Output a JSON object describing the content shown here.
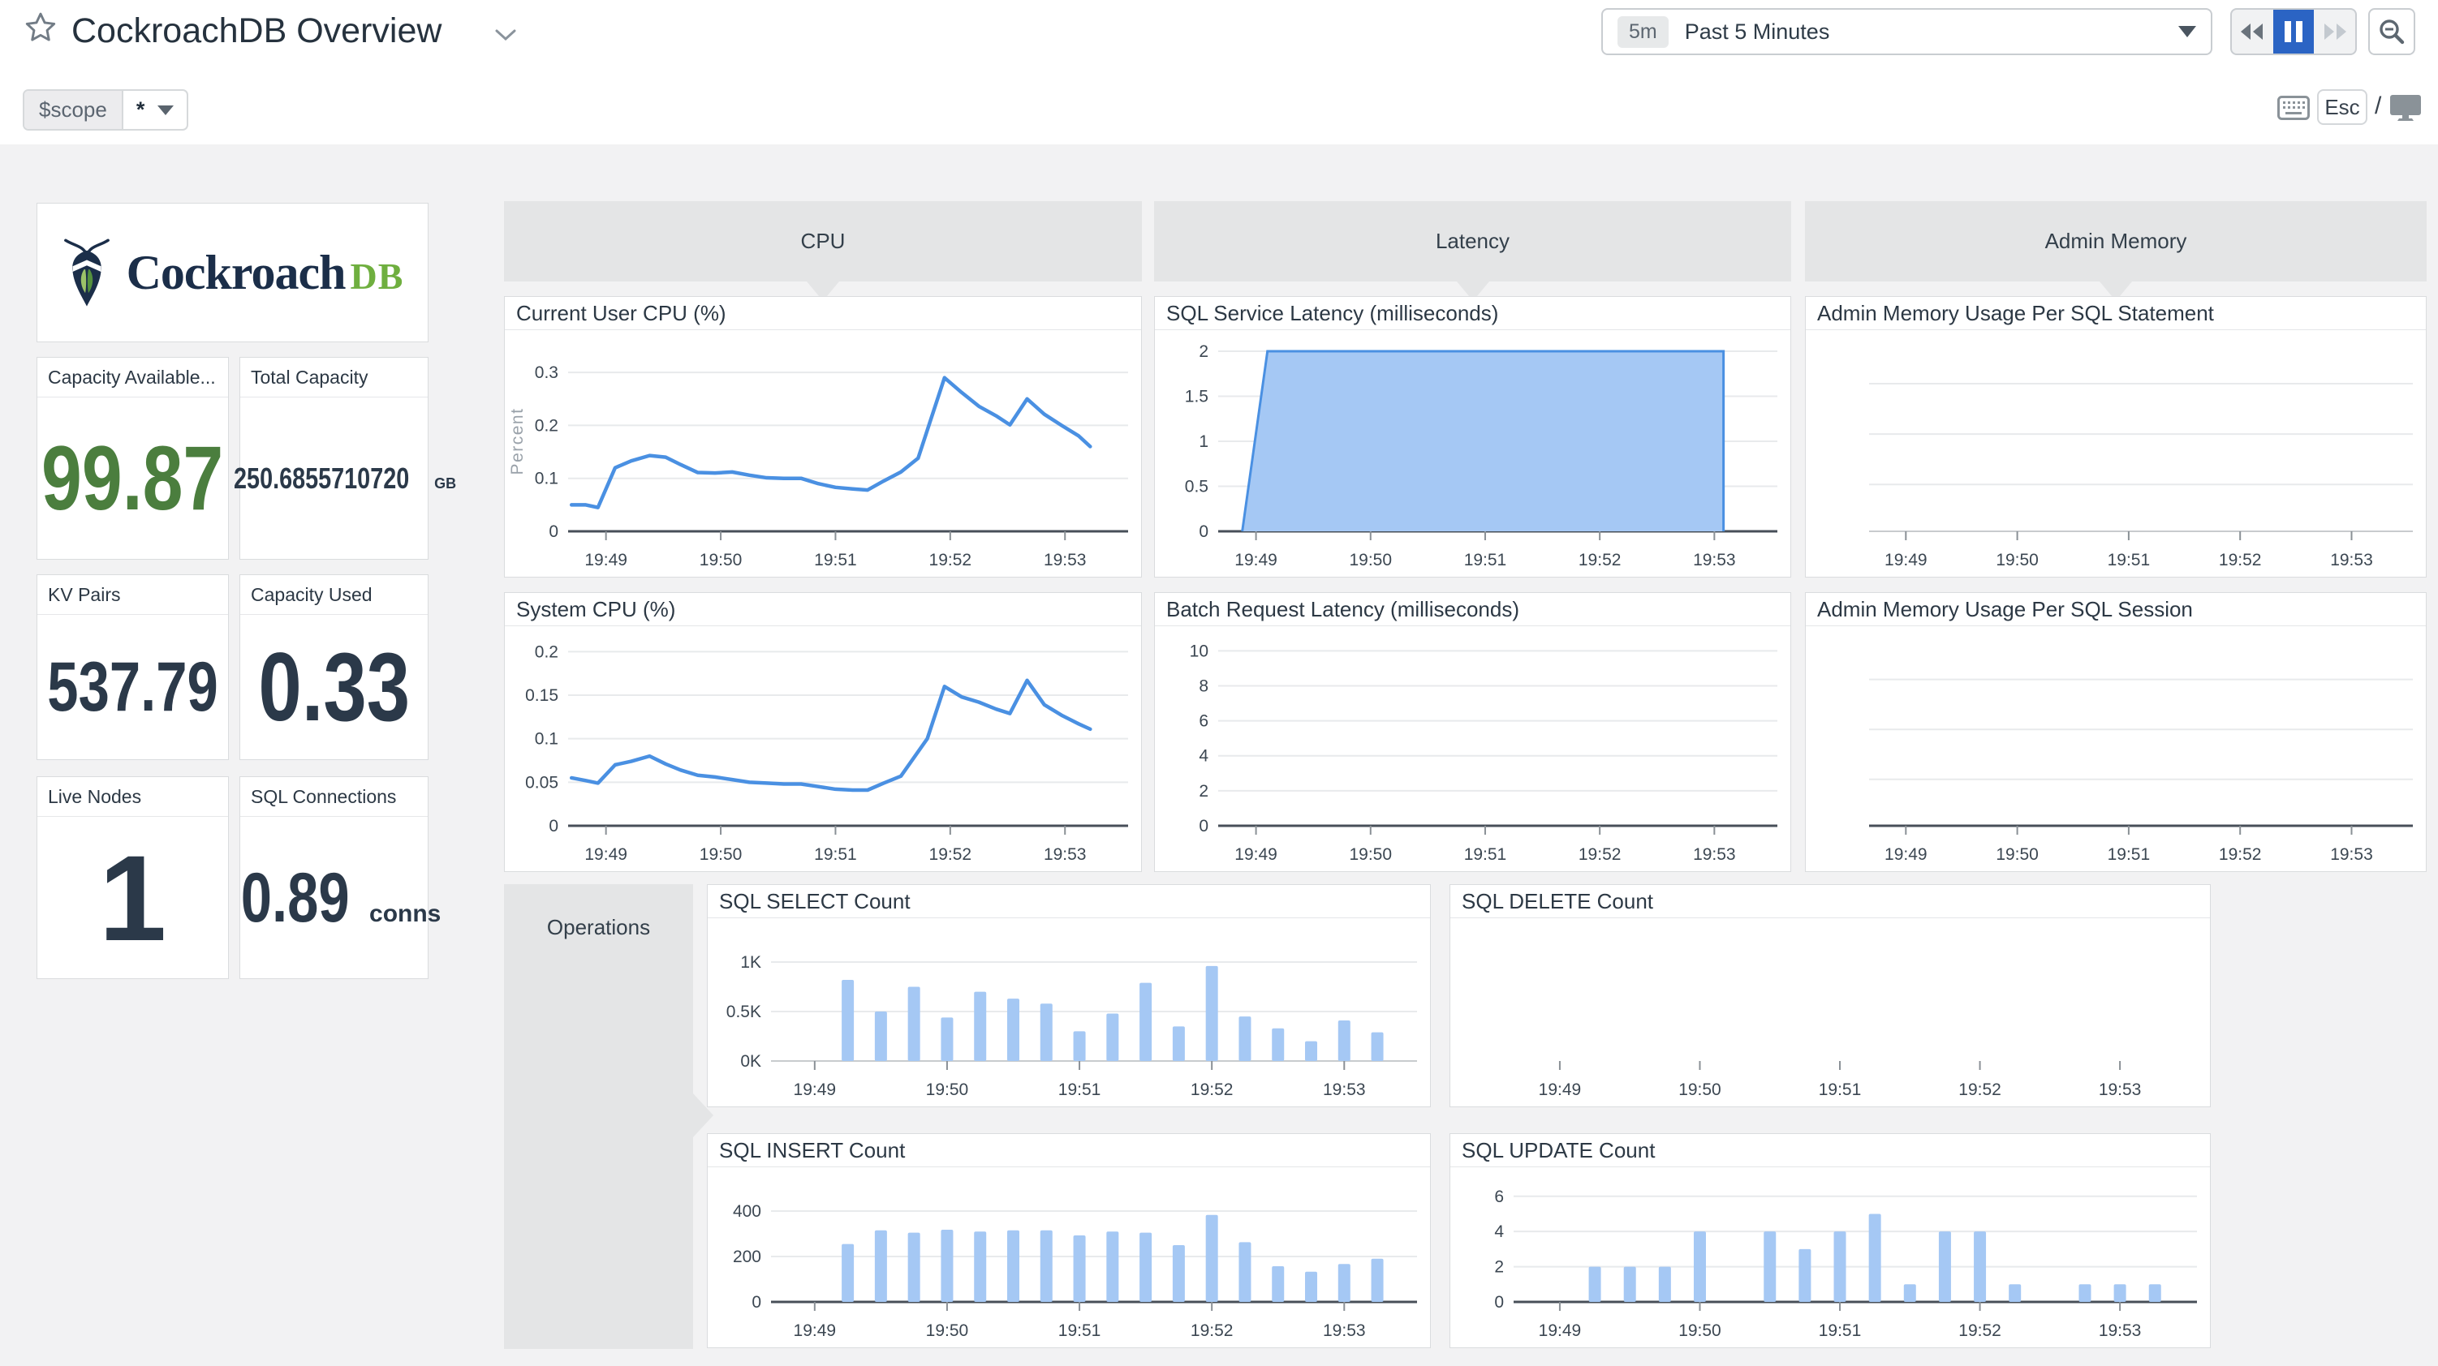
{
  "header": {
    "title": "CockroachDB Overview",
    "time": {
      "badge": "5m",
      "label": "Past 5 Minutes"
    },
    "esc": "Esc",
    "slash": "/"
  },
  "scope": {
    "label": "$scope",
    "value": "*"
  },
  "logo": {
    "word": "Cockroach",
    "suffix": "DB"
  },
  "stats": [
    {
      "title": "Capacity Available...",
      "value": "99.87",
      "unit": ""
    },
    {
      "title": "Total Capacity",
      "value": "250.6855710720",
      "unit": "GB"
    },
    {
      "title": "KV Pairs",
      "value": "537.79",
      "unit": ""
    },
    {
      "title": "Capacity Used",
      "value": "0.33",
      "unit": ""
    },
    {
      "title": "Live Nodes",
      "value": "1",
      "unit": ""
    },
    {
      "title": "SQL Connections",
      "value": "0.89",
      "unit": "conns"
    }
  ],
  "groups": [
    {
      "label": "CPU"
    },
    {
      "label": "Latency"
    },
    {
      "label": "Admin Memory"
    },
    {
      "label": "Operations"
    }
  ],
  "colors": {
    "accent_blue": "#4a90e2",
    "bar_fill": "#a5c8f4",
    "area_fill": "#a5c8f4",
    "active_blue": "#2b64c4",
    "green": "#4b7e3e",
    "navy": "#2b3949"
  },
  "chart_data": [
    {
      "id": "user_cpu",
      "type": "line",
      "title": "Current User CPU (%)",
      "ylabel": "Percent",
      "xlim": [
        48.67,
        53.55
      ],
      "ylim": [
        0,
        0.34
      ],
      "yticks": [
        0,
        0.1,
        0.2,
        0.3
      ],
      "ytick_labels": [
        "0",
        "0.1",
        "0.2",
        "0.3"
      ],
      "xticks": [
        {
          "v": 49,
          "label": "19:49"
        },
        {
          "v": 50,
          "label": "19:50"
        },
        {
          "v": 51,
          "label": "19:51"
        },
        {
          "v": 52,
          "label": "19:52"
        },
        {
          "v": 53,
          "label": "19:53"
        }
      ],
      "axis": "dark",
      "points": [
        [
          48.7,
          0.05
        ],
        [
          48.82,
          0.05
        ],
        [
          48.93,
          0.045
        ],
        [
          49.08,
          0.12
        ],
        [
          49.22,
          0.133
        ],
        [
          49.38,
          0.143
        ],
        [
          49.52,
          0.14
        ],
        [
          49.65,
          0.126
        ],
        [
          49.8,
          0.111
        ],
        [
          49.95,
          0.11
        ],
        [
          50.1,
          0.112
        ],
        [
          50.25,
          0.106
        ],
        [
          50.4,
          0.101
        ],
        [
          50.55,
          0.1
        ],
        [
          50.7,
          0.1
        ],
        [
          50.85,
          0.09
        ],
        [
          51.0,
          0.083
        ],
        [
          51.15,
          0.08
        ],
        [
          51.28,
          0.078
        ],
        [
          51.42,
          0.095
        ],
        [
          51.57,
          0.112
        ],
        [
          51.72,
          0.138
        ],
        [
          51.95,
          0.29
        ],
        [
          52.1,
          0.262
        ],
        [
          52.25,
          0.236
        ],
        [
          52.4,
          0.218
        ],
        [
          52.52,
          0.201
        ],
        [
          52.67,
          0.25
        ],
        [
          52.82,
          0.221
        ],
        [
          52.97,
          0.2
        ],
        [
          53.12,
          0.18
        ],
        [
          53.22,
          0.16
        ]
      ]
    },
    {
      "id": "system_cpu",
      "type": "line",
      "title": "System CPU (%)",
      "xlim": [
        48.67,
        53.55
      ],
      "ylim": [
        0,
        0.205
      ],
      "yticks": [
        0,
        0.05,
        0.1,
        0.15,
        0.2
      ],
      "ytick_labels": [
        "0",
        "0.05",
        "0.1",
        "0.15",
        "0.2"
      ],
      "xticks": [
        {
          "v": 49,
          "label": "19:49"
        },
        {
          "v": 50,
          "label": "19:50"
        },
        {
          "v": 51,
          "label": "19:51"
        },
        {
          "v": 52,
          "label": "19:52"
        },
        {
          "v": 53,
          "label": "19:53"
        }
      ],
      "axis": "dark",
      "points": [
        [
          48.7,
          0.055
        ],
        [
          48.82,
          0.052
        ],
        [
          48.93,
          0.049
        ],
        [
          49.08,
          0.07
        ],
        [
          49.22,
          0.074
        ],
        [
          49.38,
          0.08
        ],
        [
          49.52,
          0.071
        ],
        [
          49.65,
          0.064
        ],
        [
          49.8,
          0.058
        ],
        [
          49.95,
          0.056
        ],
        [
          50.1,
          0.053
        ],
        [
          50.25,
          0.05
        ],
        [
          50.4,
          0.049
        ],
        [
          50.55,
          0.048
        ],
        [
          50.7,
          0.048
        ],
        [
          50.85,
          0.045
        ],
        [
          51.0,
          0.042
        ],
        [
          51.15,
          0.041
        ],
        [
          51.28,
          0.041
        ],
        [
          51.42,
          0.049
        ],
        [
          51.57,
          0.057
        ],
        [
          51.8,
          0.1
        ],
        [
          51.95,
          0.16
        ],
        [
          52.1,
          0.148
        ],
        [
          52.25,
          0.142
        ],
        [
          52.4,
          0.134
        ],
        [
          52.52,
          0.129
        ],
        [
          52.67,
          0.167
        ],
        [
          52.82,
          0.139
        ],
        [
          52.97,
          0.127
        ],
        [
          53.12,
          0.117
        ],
        [
          53.22,
          0.111
        ]
      ]
    },
    {
      "id": "sql_service_latency",
      "type": "area",
      "title": "SQL Service Latency (milliseconds)",
      "xlim": [
        48.67,
        53.55
      ],
      "ylim": [
        0,
        2
      ],
      "yticks": [
        0,
        0.5,
        1,
        1.5,
        2
      ],
      "ytick_labels": [
        "0",
        "0.5",
        "1",
        "1.5",
        "2"
      ],
      "xticks": [
        {
          "v": 49,
          "label": "19:49"
        },
        {
          "v": 50,
          "label": "19:50"
        },
        {
          "v": 51,
          "label": "19:51"
        },
        {
          "v": 52,
          "label": "19:52"
        },
        {
          "v": 53,
          "label": "19:53"
        }
      ],
      "axis": "dark",
      "points": [
        [
          48.88,
          0
        ],
        [
          49.1,
          2
        ],
        [
          53.08,
          2
        ],
        [
          53.08,
          0
        ]
      ]
    },
    {
      "id": "batch_latency",
      "type": "empty",
      "title": "Batch Request Latency (milliseconds)",
      "xlim": [
        48.67,
        53.55
      ],
      "ylim": [
        0,
        10.2
      ],
      "yticks": [
        0,
        2,
        4,
        6,
        8,
        10
      ],
      "ytick_labels": [
        "0",
        "2",
        "4",
        "6",
        "8",
        "10"
      ],
      "xticks": [
        {
          "v": 49,
          "label": "19:49"
        },
        {
          "v": 50,
          "label": "19:50"
        },
        {
          "v": 51,
          "label": "19:51"
        },
        {
          "v": 52,
          "label": "19:52"
        },
        {
          "v": 53,
          "label": "19:53"
        }
      ],
      "axis": "dark"
    },
    {
      "id": "mem_statement",
      "type": "empty",
      "title": "Admin Memory Usage Per SQL Statement",
      "xlim": [
        48.67,
        53.55
      ],
      "ylim": [
        0,
        1
      ],
      "grid_frac": [
        0.18,
        0.46,
        0.74
      ],
      "xticks": [
        {
          "v": 49,
          "label": "19:49"
        },
        {
          "v": 50,
          "label": "19:50"
        },
        {
          "v": 51,
          "label": "19:51"
        },
        {
          "v": 52,
          "label": "19:52"
        },
        {
          "v": 53,
          "label": "19:53"
        }
      ],
      "axis": "light"
    },
    {
      "id": "mem_session",
      "type": "empty",
      "title": "Admin Memory Usage Per SQL Session",
      "xlim": [
        48.67,
        53.55
      ],
      "ylim": [
        0,
        1
      ],
      "grid_frac": [
        0.18,
        0.46,
        0.74
      ],
      "xticks": [
        {
          "v": 49,
          "label": "19:49"
        },
        {
          "v": 50,
          "label": "19:50"
        },
        {
          "v": 51,
          "label": "19:51"
        },
        {
          "v": 52,
          "label": "19:52"
        },
        {
          "v": 53,
          "label": "19:53"
        }
      ],
      "axis": "dark"
    },
    {
      "id": "select_count",
      "type": "bars",
      "title": "SQL SELECT Count",
      "xlim": [
        48.67,
        53.55
      ],
      "ylim": [
        0,
        1230
      ],
      "yticks": [
        0,
        500,
        1000
      ],
      "ytick_labels": [
        "0K",
        "0.5K",
        "1K"
      ],
      "xticks": [
        {
          "v": 49,
          "label": "19:49"
        },
        {
          "v": 50,
          "label": "19:50"
        },
        {
          "v": 51,
          "label": "19:51"
        },
        {
          "v": 52,
          "label": "19:52"
        },
        {
          "v": 53,
          "label": "19:53"
        }
      ],
      "axis": "light",
      "bars": {
        "t0": 49.25,
        "dt": 0.25,
        "values": [
          820,
          500,
          750,
          440,
          700,
          630,
          580,
          300,
          480,
          790,
          350,
          960,
          450,
          330,
          200,
          410,
          290
        ]
      }
    },
    {
      "id": "delete_count",
      "type": "empty",
      "title": "SQL DELETE Count",
      "xlim": [
        48.67,
        53.55
      ],
      "ylim": [
        0,
        1
      ],
      "xticks": [
        {
          "v": 49,
          "label": "19:49"
        },
        {
          "v": 50,
          "label": "19:50"
        },
        {
          "v": 51,
          "label": "19:51"
        },
        {
          "v": 52,
          "label": "19:52"
        },
        {
          "v": 53,
          "label": "19:53"
        }
      ],
      "axis": "none"
    },
    {
      "id": "insert_count",
      "type": "bars",
      "title": "SQL INSERT Count",
      "xlim": [
        48.67,
        53.55
      ],
      "ylim": [
        0,
        500
      ],
      "yticks": [
        0,
        200,
        400
      ],
      "ytick_labels": [
        "0",
        "200",
        "400"
      ],
      "xticks": [
        {
          "v": 49,
          "label": "19:49"
        },
        {
          "v": 50,
          "label": "19:50"
        },
        {
          "v": 51,
          "label": "19:51"
        },
        {
          "v": 52,
          "label": "19:52"
        },
        {
          "v": 53,
          "label": "19:53"
        }
      ],
      "axis": "dark",
      "bars": {
        "t0": 49.25,
        "dt": 0.25,
        "values": [
          255,
          315,
          305,
          318,
          310,
          315,
          315,
          293,
          310,
          305,
          250,
          383,
          263,
          157,
          133,
          167,
          190
        ]
      }
    },
    {
      "id": "update_count",
      "type": "bars",
      "title": "SQL UPDATE Count",
      "xlim": [
        48.67,
        53.55
      ],
      "ylim": [
        0,
        6.45
      ],
      "yticks": [
        0,
        2,
        4,
        6
      ],
      "ytick_labels": [
        "0",
        "2",
        "4",
        "6"
      ],
      "xticks": [
        {
          "v": 49,
          "label": "19:49"
        },
        {
          "v": 50,
          "label": "19:50"
        },
        {
          "v": 51,
          "label": "19:51"
        },
        {
          "v": 52,
          "label": "19:52"
        },
        {
          "v": 53,
          "label": "19:53"
        }
      ],
      "axis": "dark",
      "bars": {
        "t0": 49.25,
        "dt": 0.25,
        "values": [
          2,
          2,
          2,
          4,
          0,
          4,
          3,
          4,
          5,
          1,
          4,
          4,
          1,
          0,
          1,
          1,
          1
        ]
      }
    }
  ]
}
